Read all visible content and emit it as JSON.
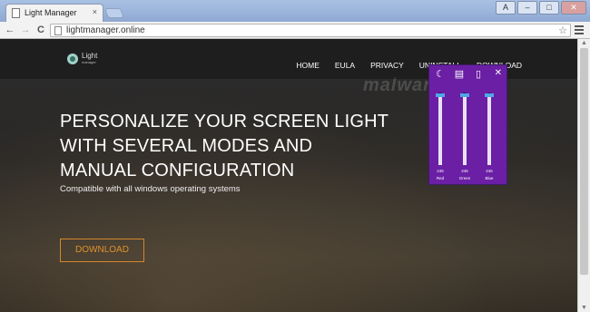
{
  "browser": {
    "tab_title": "Light Manager",
    "tab_close": "×",
    "address": "lightmanager.online",
    "back": "←",
    "forward": "→",
    "reload": "C",
    "star": "☆",
    "window_buttons": [
      "A",
      "–",
      "□",
      "✕"
    ]
  },
  "site": {
    "logo_text": "Light",
    "logo_sub": "manager",
    "nav": [
      "HOME",
      "EULA",
      "PRIVACY",
      "UNINSTALL",
      "DOWNLOAD"
    ],
    "headline_lines": [
      "PERSONALIZE YOUR SCREEN LIGHT",
      "WITH SEVERAL MODES AND",
      "MANUAL CONFIGURATION"
    ],
    "subline": "Compatible with all windows operating systems",
    "download_button": "DOWNLOAD",
    "watermark": "malwarefixes"
  },
  "widget": {
    "icons": [
      "moon-icon",
      "clapperboard-icon",
      "book-icon"
    ],
    "close": "✕",
    "sliders": [
      {
        "label": "Red",
        "value": "245",
        "level": 0.96
      },
      {
        "label": "Green",
        "value": "245",
        "level": 0.96
      },
      {
        "label": "Blue",
        "value": "245",
        "level": 0.96
      }
    ]
  },
  "colors": {
    "accent": "#e0912c",
    "widget_bg": "#6a1fa5",
    "slider_thumb": "#4fa6e8"
  }
}
